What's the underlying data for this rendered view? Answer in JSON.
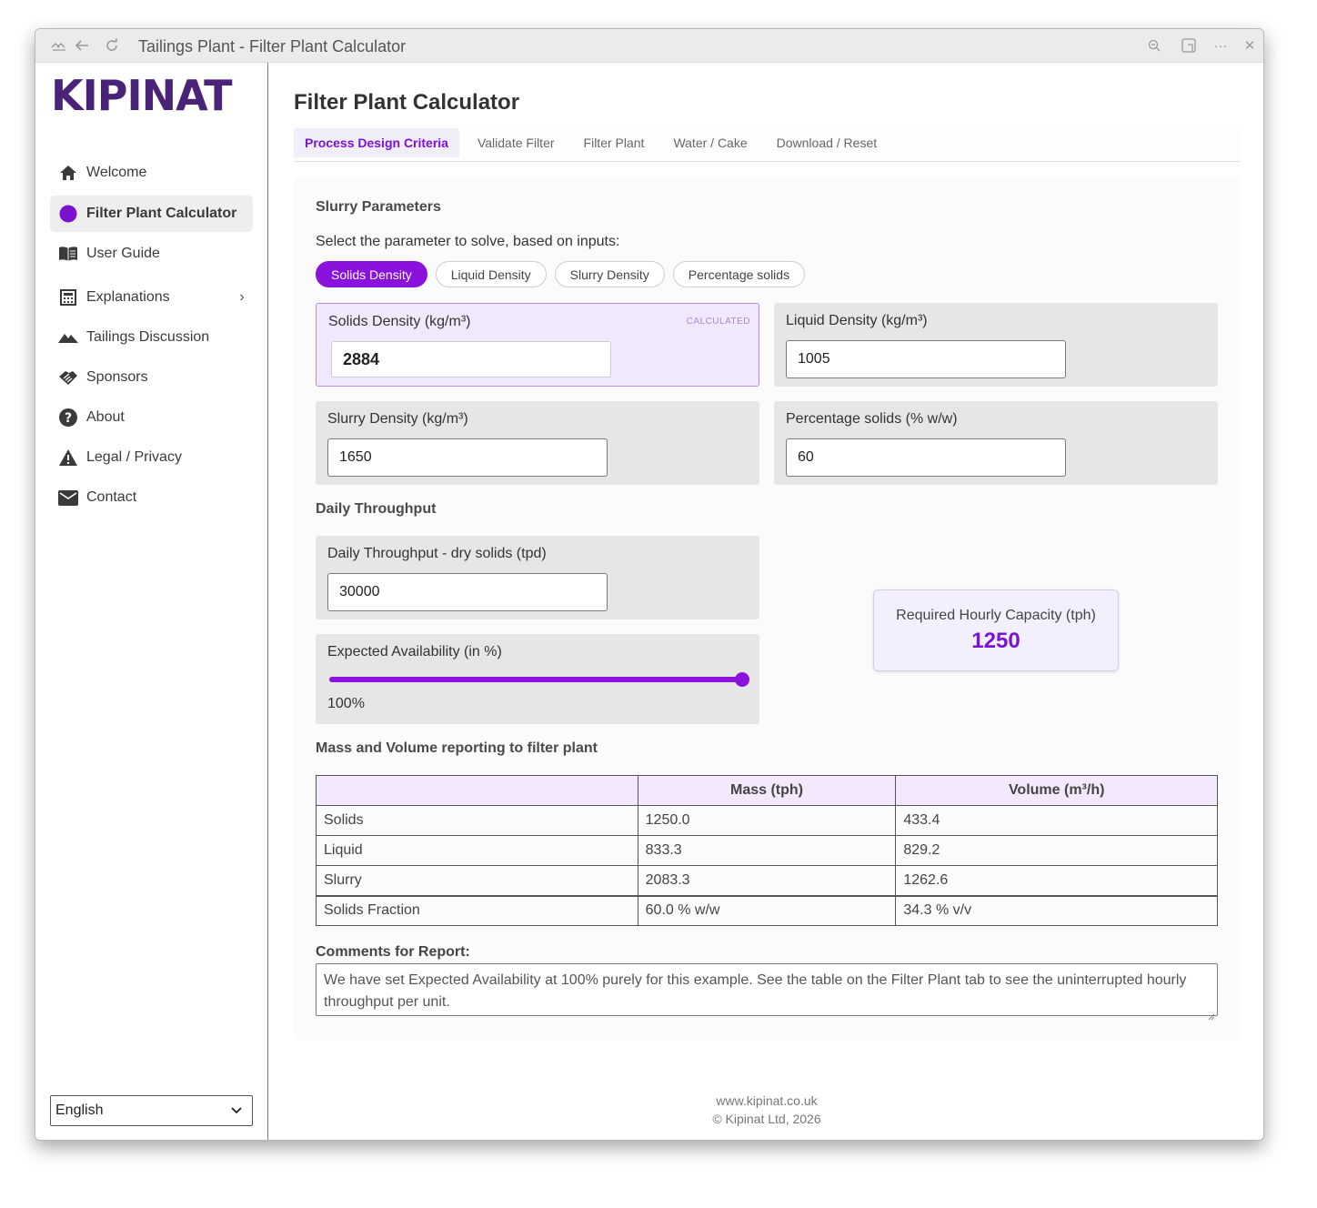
{
  "window": {
    "title": "Tailings Plant - Filter Plant Calculator"
  },
  "sidebar": {
    "logo": "KIPINAT",
    "items": [
      {
        "label": "Welcome",
        "icon": "home-icon"
      },
      {
        "label": "Filter Plant Calculator",
        "icon": "circle-icon",
        "active": true
      },
      {
        "label": "User Guide",
        "icon": "book-icon"
      },
      {
        "label": "Explanations",
        "icon": "calculator-icon",
        "has_submenu": true
      },
      {
        "label": "Tailings Discussion",
        "icon": "mountains-icon"
      },
      {
        "label": "Sponsors",
        "icon": "handshake-icon"
      },
      {
        "label": "About",
        "icon": "question-icon"
      },
      {
        "label": "Legal / Privacy",
        "icon": "warning-icon"
      },
      {
        "label": "Contact",
        "icon": "mail-icon"
      }
    ],
    "language": "English"
  },
  "main": {
    "title": "Filter Plant Calculator",
    "tabs": [
      {
        "label": "Process Design Criteria",
        "active": true
      },
      {
        "label": "Validate Filter"
      },
      {
        "label": "Filter Plant"
      },
      {
        "label": "Water / Cake"
      },
      {
        "label": "Download / Reset"
      }
    ],
    "slurry": {
      "title": "Slurry Parameters",
      "instruction": "Select the parameter to solve, based on inputs:",
      "options": [
        "Solids Density",
        "Liquid Density",
        "Slurry Density",
        "Percentage solids"
      ],
      "selected": "Solids Density",
      "calculated_badge": "CALCULATED",
      "fields": {
        "solids_density": {
          "label": "Solids Density (kg/m³)",
          "value": "2884"
        },
        "liquid_density": {
          "label": "Liquid Density (kg/m³)",
          "value": "1005"
        },
        "slurry_density": {
          "label": "Slurry Density (kg/m³)",
          "value": "1650"
        },
        "percent_solids": {
          "label": "Percentage solids (% w/w)",
          "value": "60"
        }
      }
    },
    "throughput": {
      "title": "Daily Throughput",
      "daily_label": "Daily Throughput - dry solids (tpd)",
      "daily_value": "30000",
      "availability_label": "Expected Availability (in %)",
      "availability_value": 100,
      "availability_text": "100%",
      "capacity_label": "Required Hourly Capacity (tph)",
      "capacity_value": "1250"
    },
    "mass_volume": {
      "title": "Mass and Volume reporting to filter plant",
      "headers": [
        "",
        "Mass (tph)",
        "Volume (m³/h)"
      ],
      "rows": [
        [
          "Solids",
          "1250.0",
          "433.4"
        ],
        [
          "Liquid",
          "833.3",
          "829.2"
        ],
        [
          "Slurry",
          "2083.3",
          "1262.6"
        ],
        [
          "Solids Fraction",
          "60.0 % w/w",
          "34.3 % v/v"
        ]
      ]
    },
    "comments": {
      "label": "Comments for Report:",
      "text": "We have set Expected Availability at 100% purely for this example. See the table on the Filter Plant tab to see the uninterrupted hourly throughput per unit."
    },
    "footer": {
      "url": "www.kipinat.co.uk",
      "copyright": "© Kipinat Ltd, 2026"
    }
  },
  "colors": {
    "accent": "#8a12dc",
    "brand": "#4a2378"
  }
}
